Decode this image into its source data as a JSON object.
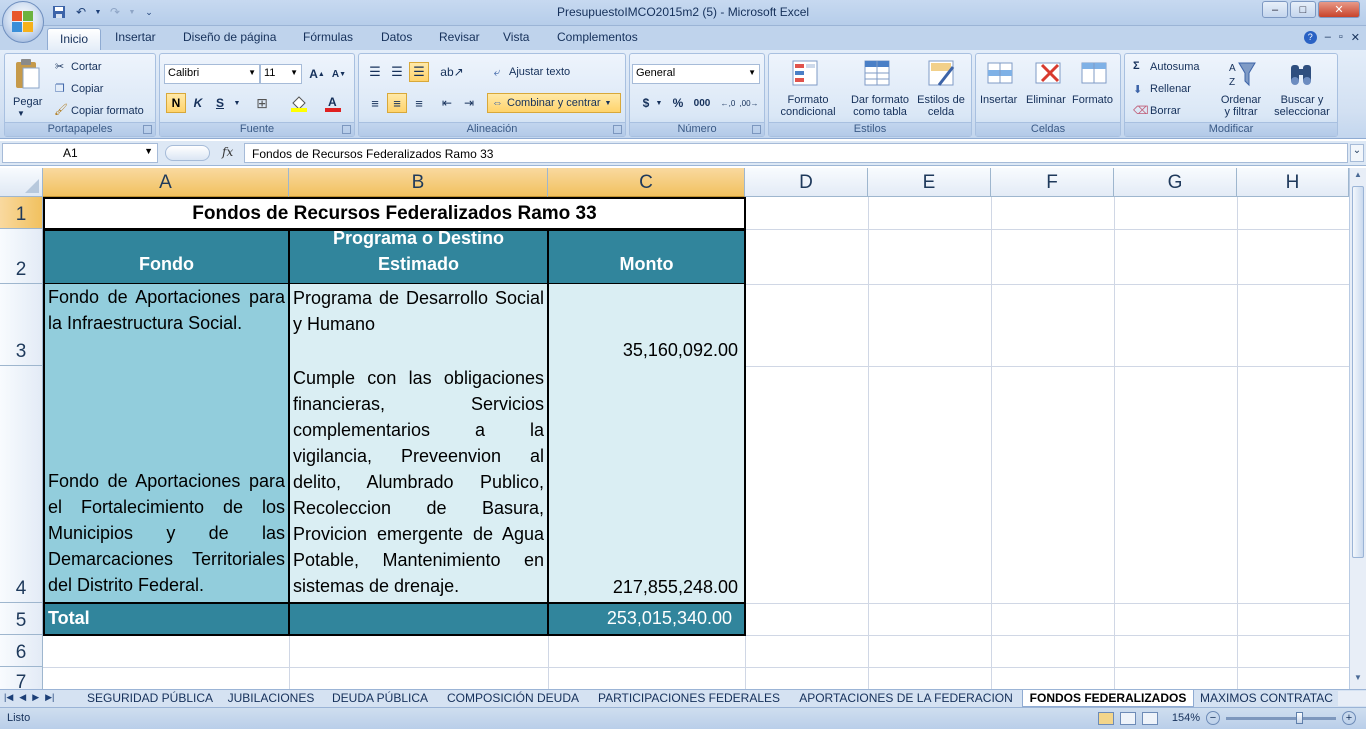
{
  "window": {
    "title": "PresupuestoIMCO2015m2 (5) - Microsoft Excel",
    "minimize": "–",
    "maximize": "□",
    "close": "✕"
  },
  "ribbon_tabs": [
    "Inicio",
    "Insertar",
    "Diseño de página",
    "Fórmulas",
    "Datos",
    "Revisar",
    "Vista",
    "Complementos"
  ],
  "ribbon": {
    "portapapeles": {
      "label": "Portapapeles",
      "paste": "Pegar",
      "cut": "Cortar",
      "copy": "Copiar",
      "format_painter": "Copiar formato"
    },
    "fuente": {
      "label": "Fuente",
      "font": "Calibri",
      "size": "11",
      "bold": "N",
      "italic": "K",
      "underline": "S"
    },
    "alineacion": {
      "label": "Alineación",
      "wrap": "Ajustar texto",
      "merge": "Combinar y centrar"
    },
    "numero": {
      "label": "Número",
      "format": "General",
      "currency": "$",
      "percent": "%",
      "thousands": "000",
      "inc_dec": "←,0 ,00",
      "dec_dec": ",00 →,0"
    },
    "estilos": {
      "label": "Estilos",
      "conditional": "Formato\ncondicional",
      "as_table": "Dar formato\ncomo tabla",
      "cell_styles": "Estilos de\ncelda"
    },
    "celdas": {
      "label": "Celdas",
      "insert": "Insertar",
      "delete": "Eliminar",
      "format": "Formato"
    },
    "modificar": {
      "label": "Modificar",
      "autosum": "Autosuma",
      "fill": "Rellenar",
      "clear": "Borrar",
      "sort": "Ordenar\ny filtrar",
      "find": "Buscar y\nseleccionar"
    }
  },
  "formula_bar": {
    "name_box": "A1",
    "fx": "fx",
    "content": "Fondos de Recursos Federalizados Ramo 33"
  },
  "columns": [
    "A",
    "B",
    "C",
    "D",
    "E",
    "F",
    "G",
    "H"
  ],
  "rows": [
    "1",
    "2",
    "3",
    "4",
    "5",
    "6",
    "7"
  ],
  "sheet": {
    "title": "Fondos de Recursos Federalizados Ramo 33",
    "headers": {
      "fondo": "Fondo",
      "programa": "Programa o Destino Estimado",
      "monto": "Monto"
    },
    "row3": {
      "fondo": "Fondo de Aportaciones para la Infraestructura Social.",
      "programa": "Programa de Desarrollo Social y Humano",
      "monto": "35,160,092.00"
    },
    "row4": {
      "fondo": "Fondo de Aportaciones para el Fortalecimiento de los Municipios y de las Demarcaciones Territoriales del Distrito Federal.",
      "programa": "Cumple con las obligaciones financieras, Servicios complementarios a la vigilancia, Preveenvion al delito, Alumbrado Publico, Recoleccion de Basura, Provicion emergente de Agua Potable, Mantenimiento en sistemas de drenaje.",
      "monto": "217,855,248.00"
    },
    "total": {
      "label": "Total",
      "monto": "253,015,340.00"
    }
  },
  "sheet_tabs": [
    "SEGURIDAD PÚBLICA",
    "JUBILACIONES",
    "DEUDA PÚBLICA",
    "COMPOSICIÓN DEUDA",
    "PARTICIPACIONES FEDERALES",
    "APORTACIONES DE LA FEDERACION",
    "FONDOS FEDERALIZADOS",
    "MAXIMOS CONTRATAC"
  ],
  "status": {
    "ready": "Listo",
    "zoom": "154%",
    "minus": "−",
    "plus": "+"
  },
  "colors": {
    "header_teal": "#31859c",
    "fondo_fill": "#92cddc",
    "body_fill": "#daeef3"
  }
}
